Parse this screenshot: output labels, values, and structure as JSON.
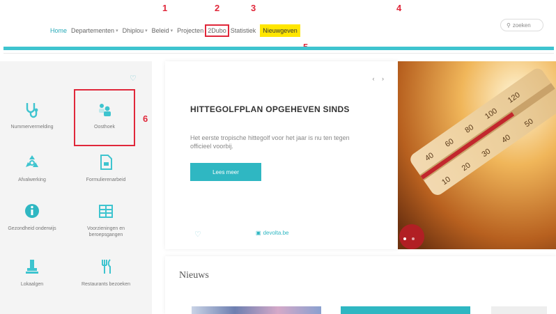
{
  "nav": {
    "items": [
      {
        "label": "Home",
        "has_chevron": false
      },
      {
        "label": "Departementen",
        "has_chevron": true
      },
      {
        "label": "Dhiplou",
        "has_chevron": true
      },
      {
        "label": "Beleid",
        "has_chevron": true
      },
      {
        "label": "Projecten",
        "has_chevron": false
      },
      {
        "label": "2Dubo",
        "has_chevron": false
      },
      {
        "label": "Statistiek",
        "has_chevron": false
      },
      {
        "label": "Nieuwgeven",
        "has_chevron": false
      }
    ],
    "search_placeholder": "zoeken"
  },
  "annotations": [
    "1",
    "2",
    "3",
    "4",
    "5",
    "6"
  ],
  "sidebar": {
    "tiles": [
      {
        "label": "Nummervermelding",
        "icon": "stethoscope-icon"
      },
      {
        "label": "Oosthoek",
        "icon": "people-icon"
      },
      {
        "label": "Afvalwerking",
        "icon": "recycle-icon"
      },
      {
        "label": "Formulierenarbeid",
        "icon": "document-icon"
      },
      {
        "label": "Gezondheid onderwijs",
        "icon": "info-icon"
      },
      {
        "label": "Voorzieningen en beroepsgangen",
        "icon": "calendar-grid-icon"
      },
      {
        "label": "Lokaalgen",
        "icon": "tool-icon"
      },
      {
        "label": "Restaurants bezoeken",
        "icon": "cutlery-icon"
      }
    ]
  },
  "card": {
    "pager": "‹ ›",
    "title": "HITTEGOLFPLAN OPGEHEVEN SINDS",
    "description": "Het eerste tropische hittegolf voor het jaar is nu ten tegen officieel voorbij.",
    "button_label": "Lees meer",
    "link_label": "devolta.be"
  },
  "news": {
    "title": "Nieuws"
  },
  "colors": {
    "accent": "#2fb7c2",
    "highlight": "#ffe600",
    "annotation": "#e0273a"
  }
}
